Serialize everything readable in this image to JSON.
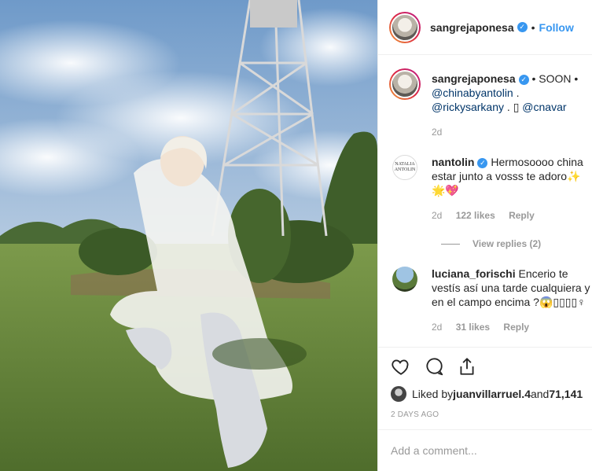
{
  "post": {
    "author": "sangrejaponesa",
    "follow_label": "Follow",
    "dot": "•"
  },
  "caption": {
    "username": "sangrejaponesa",
    "text_1": " • SOON •",
    "mention_1": "@chinabyantolin",
    "text_2": " .",
    "mention_2": "@rickysarkany",
    "text_3": " . ",
    "glyph": "▯",
    "mention_3": "@cnavar",
    "age": "2d"
  },
  "comments": [
    {
      "username": "nantolin",
      "avatar_text": "NATALIA ANTOLIN",
      "text": "Hermosoooo china estar junto a vosss te adoro✨🌟💖",
      "age": "2d",
      "likes": "122 likes",
      "reply_label": "Reply",
      "view_replies": "View replies (2)"
    },
    {
      "username": "luciana_forischi",
      "text": "Encerio te vestís así una tarde cualquiera y en el campo encima ?😱▯▯▯▯♀",
      "age": "2d",
      "likes": "31 likes",
      "reply_label": "Reply"
    }
  ],
  "likes_line": {
    "prefix": "Liked by ",
    "user": "juanvillarruel.4",
    "middle": " and ",
    "count": "71,141"
  },
  "date": "2 DAYS AGO",
  "comment_box": {
    "placeholder": "Add a comment..."
  },
  "icons": [
    "heart-icon",
    "comment-icon",
    "share-icon",
    "verified-badge-icon"
  ],
  "colors": {
    "link": "#3897f0",
    "mention": "#003569",
    "muted": "#999999",
    "text": "#262626"
  }
}
